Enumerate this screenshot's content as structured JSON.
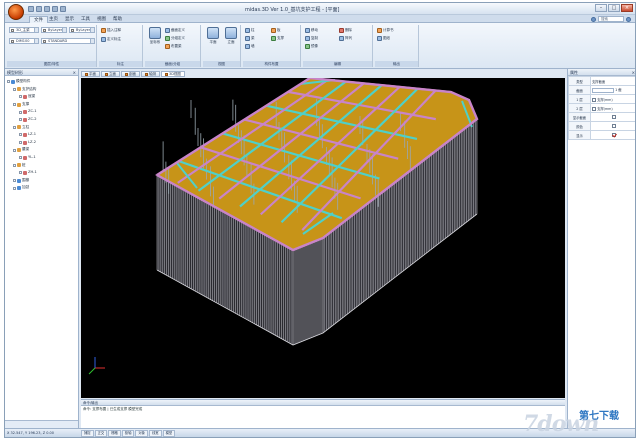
{
  "app": {
    "orb_label": "",
    "window_title": "midas.3D Ver 1.0_基坑支护工程 - [平面]"
  },
  "ribbon_tabs": [
    "文件",
    "主页",
    "显示",
    "工具",
    "视图",
    "帮助"
  ],
  "ribbon": {
    "search_placeholder": "搜索",
    "groups": [
      {
        "caption": "图层/特性",
        "combos": [
          "3D_主梁",
          "ByLayer",
          "ByLayer",
          "DIM100",
          "STANDARD"
        ]
      },
      {
        "caption": "标注",
        "buttons": [
          "插入注释",
          "定义标注"
        ]
      },
      {
        "caption": "截面/分组",
        "buttons": [
          "坐标系",
          "截面定义",
          "分组定义",
          "布置梁"
        ]
      },
      {
        "caption": "视图",
        "buttons": [
          "平面",
          "立面"
        ]
      },
      {
        "caption": "构件布置",
        "buttons": [
          "柱",
          "梁",
          "墙",
          "板",
          "支撑"
        ]
      },
      {
        "caption": "编辑",
        "buttons": [
          "移动",
          "复制",
          "镜像",
          "删除",
          "阵列"
        ]
      },
      {
        "caption": "输出",
        "buttons": [
          "计算书",
          "图纸"
        ]
      }
    ]
  },
  "tree": {
    "title": "模型树形",
    "close": "×",
    "items": [
      {
        "label": "模型构件",
        "level": 0,
        "color": "#4a8ad4"
      },
      {
        "label": "支护结构",
        "level": 1,
        "color": "#e0a040"
      },
      {
        "label": "冠梁",
        "level": 2,
        "color": "#d06a6a"
      },
      {
        "label": "支撑",
        "level": 1,
        "color": "#e0a040"
      },
      {
        "label": "ZC-1",
        "level": 2,
        "color": "#d06a6a"
      },
      {
        "label": "ZC-2",
        "level": 2,
        "color": "#d06a6a"
      },
      {
        "label": "立柱",
        "level": 1,
        "color": "#e0a040"
      },
      {
        "label": "LZ-1",
        "level": 2,
        "color": "#d06a6a"
      },
      {
        "label": "LZ-2",
        "level": 2,
        "color": "#d06a6a"
      },
      {
        "label": "腰梁",
        "level": 1,
        "color": "#e0a040"
      },
      {
        "label": "YL-1",
        "level": 2,
        "color": "#d06a6a"
      },
      {
        "label": "桩",
        "level": 1,
        "color": "#e0a040"
      },
      {
        "label": "ZH-1",
        "level": 2,
        "color": "#d06a6a"
      },
      {
        "label": "围檩",
        "level": 1,
        "color": "#4a8ad4"
      },
      {
        "label": "加劲",
        "level": 1,
        "color": "#4a8ad4"
      }
    ]
  },
  "doc_tabs": [
    "平面",
    "立面",
    "剖面",
    "轴测",
    "3D视图"
  ],
  "properties": {
    "title": "属性",
    "rows": [
      {
        "label": "类型",
        "value": "支撑截面"
      },
      {
        "label": "截面",
        "value": "1 截"
      },
      {
        "label": "1 层",
        "value": "支撑(mm)"
      },
      {
        "label": "2 层",
        "value": "支撑(mm)"
      },
      {
        "label": "显示截面",
        "value": ""
      },
      {
        "label": "颜色",
        "value": ""
      },
      {
        "label": "显示",
        "value": ""
      }
    ]
  },
  "output": {
    "title": "命令/输出",
    "line": "命令: 支撑布置 | 已生成支撑 模型完成"
  },
  "status": {
    "coords": "X 32.547, Y 196.23, Z 0.00",
    "cells": [
      "捕捉",
      "正交",
      "栅格",
      "极轴",
      "对象",
      "线宽",
      "模型"
    ]
  },
  "watermark": {
    "site": "第七下载",
    "mark": "7down"
  },
  "colors": {
    "pit_fill": "#c79418",
    "frame_cyan": "#4fd0c8",
    "frame_pink": "#c884c8",
    "piles": "#b0b0b8",
    "background": "#000000"
  }
}
